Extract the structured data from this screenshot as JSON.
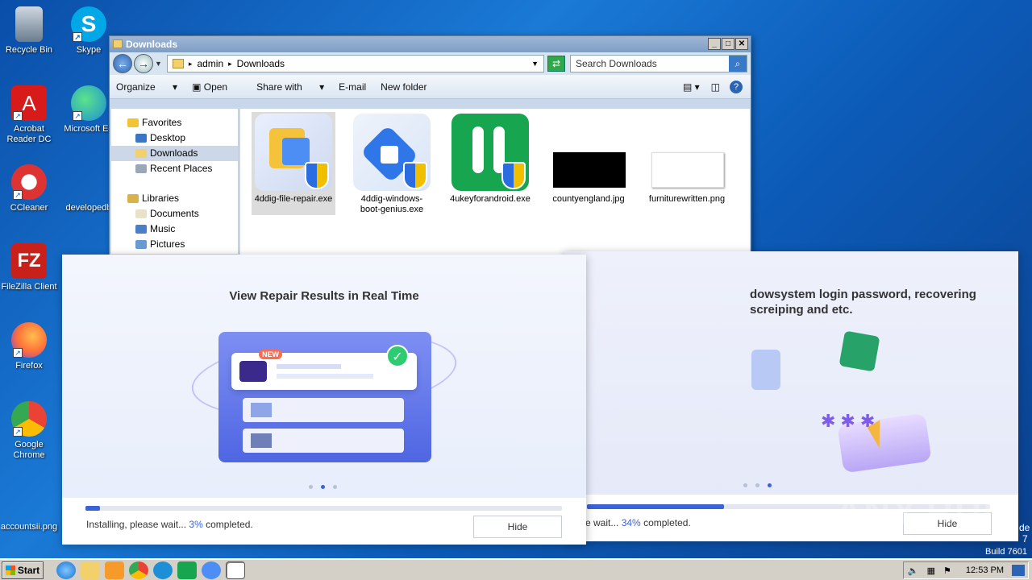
{
  "desktop": {
    "icons": [
      {
        "label": "Recycle Bin",
        "icon": "recycle-bin-icon",
        "color": "#6a7c8e"
      },
      {
        "label": "Skype",
        "icon": "skype-icon",
        "color": "#00a8e8"
      },
      {
        "label": "Acrobat Reader DC",
        "icon": "acrobat-icon",
        "color": "#d71a1a"
      },
      {
        "label": "Microsoft Ed",
        "icon": "edge-icon",
        "color": "#1d8fd6"
      },
      {
        "label": "CCleaner",
        "icon": "ccleaner-icon",
        "color": "#d33"
      },
      {
        "label": "developedb",
        "icon": "file-icon",
        "color": "#1a73c8"
      },
      {
        "label": "FileZilla Client",
        "icon": "filezilla-icon",
        "color": "#c8211b"
      },
      {
        "label": "Firefox",
        "icon": "firefox-icon",
        "color": "#ff7139"
      },
      {
        "label": "Google Chrome",
        "icon": "chrome-icon",
        "color": "#34a853"
      },
      {
        "label": "accountsii.png",
        "icon": "image-file-icon",
        "color": "#2a5ea6"
      }
    ]
  },
  "explorer": {
    "title": "Downloads",
    "breadcrumb": [
      "admin",
      "Downloads"
    ],
    "search_placeholder": "Search Downloads",
    "toolbar": {
      "organize": "Organize",
      "open": "Open",
      "share": "Share with",
      "email": "E-mail",
      "new_folder": "New folder"
    },
    "nav": {
      "favorites": "Favorites",
      "fav_items": [
        "Desktop",
        "Downloads",
        "Recent Places"
      ],
      "libraries": "Libraries",
      "lib_items": [
        "Documents",
        "Music",
        "Pictures"
      ]
    },
    "files": [
      {
        "name": "4ddig-file-repair.exe",
        "icon": "4ddig-file-repair-icon"
      },
      {
        "name": "4ddig-windows-boot-genius.exe",
        "icon": "4ddig-boot-genius-icon"
      },
      {
        "name": "4ukeyforandroid.exe",
        "icon": "4ukey-icon"
      },
      {
        "name": "countyengland.jpg",
        "icon": "image-thumbnail"
      },
      {
        "name": "furniturewritten.png",
        "icon": "image-thumbnail"
      }
    ]
  },
  "installer_front": {
    "heading": "View Repair Results in Real Time",
    "badge": "NEW",
    "status_prefix": "Installing, please wait...",
    "percent": "3%",
    "status_suffix": "completed.",
    "progress": 0.03,
    "hide": "Hide"
  },
  "installer_back": {
    "heading_line1": "dowsystem login password, recovering",
    "heading_line2": "screiping and etc.",
    "status_prefix": "se wait...",
    "percent": "34%",
    "status_suffix": "completed.",
    "progress": 0.34,
    "hide": "Hide"
  },
  "overlay": {
    "watermark": "ANY.RUN",
    "build": "Build 7601",
    "side_text_1": "de",
    "side_text_2": "7"
  },
  "taskbar": {
    "start": "Start",
    "clock": "12:53 PM"
  }
}
